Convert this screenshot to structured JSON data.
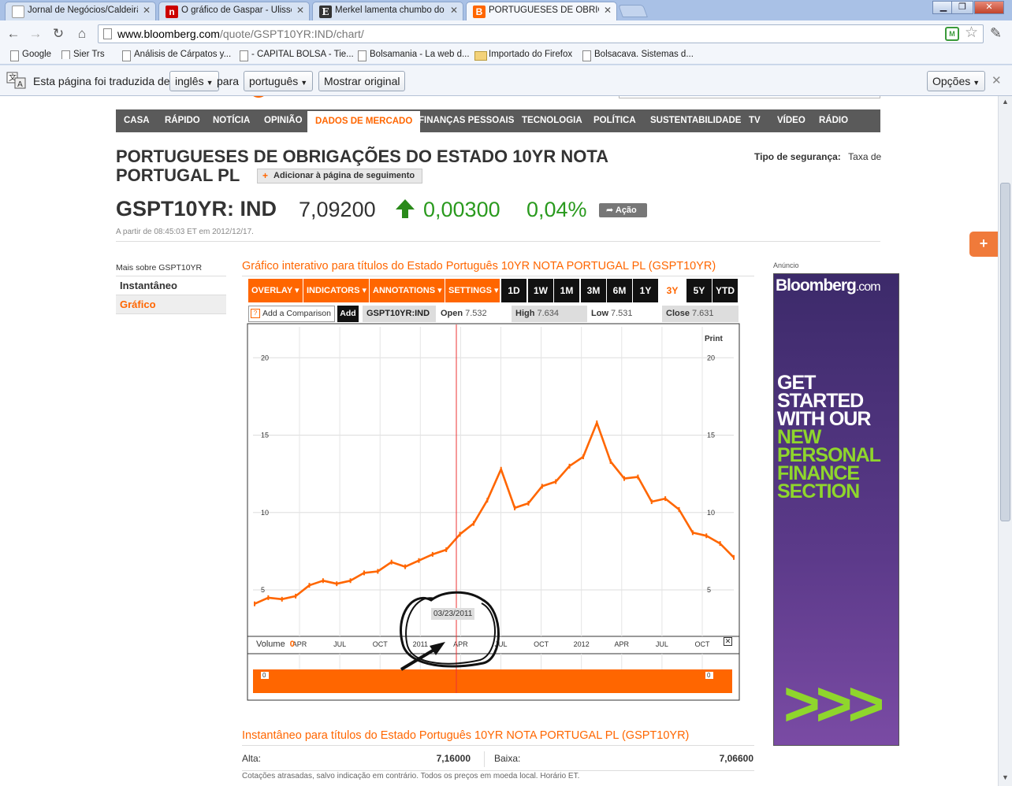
{
  "browser": {
    "tabs": [
      {
        "title": "Jornal de Negócios/Caldeirão",
        "icon": "page-icon"
      },
      {
        "title": "O gráfico de Gaspar - Ulisses",
        "icon": "n-favicon"
      },
      {
        "title": "Merkel lamenta chumbo do Pl",
        "icon": "e-favicon"
      },
      {
        "title": "PORTUGUESES DE OBRIGAÇ",
        "icon": "bloomberg-favicon"
      }
    ],
    "url_host": "www.bloomberg.com",
    "url_path": "/quote/GSPT10YR:IND/chart/",
    "bookmarks": [
      "Google",
      "Sier Trs",
      "Análisis de Cárpatos y...",
      "- CAPITAL BOLSA - Tie...",
      "Bolsamania - La web d...",
      "Importado do Firefox",
      "Bolsacava. Sistemas d..."
    ],
    "translate_bar": {
      "text1": "Esta página foi traduzida de",
      "from_lang": "inglês",
      "text2": "para",
      "to_lang": "português",
      "show_original": "Mostrar original",
      "options": "Opções"
    }
  },
  "nav": {
    "items": [
      "CASA",
      "RÁPIDO",
      "NOTÍCIA",
      "OPINIÃO",
      "DADOS DE MERCADO",
      "FINANÇAS PESSOAIS",
      "TECNOLOGIA",
      "POLÍTICA",
      "SUSTENTABILIDADE",
      "TV",
      "VÍDEO",
      "RÁDIO"
    ],
    "active": "DADOS DE MERCADO"
  },
  "quote": {
    "title_line1": "PORTUGUESES DE OBRIGAÇÕES DO ESTADO 10YR NOTA",
    "title_line2": "PORTUGAL PL",
    "follow_button": "Adicionar à página de seguimento",
    "security_type_label": "Tipo de segurança:",
    "security_type_value": "Taxa de",
    "ticker": "GSPT10YR: IND",
    "price": "7,09200",
    "change": "0,00300",
    "change_pct": "0,04%",
    "share_button": "Ação",
    "timestamp": "A partir de 08:45:03 ET em 2012/12/17.",
    "up_color": "#2a9a1e"
  },
  "left_nav": {
    "heading": "Mais sobre GSPT10YR",
    "items": [
      "Instantâneo",
      "Gráfico"
    ],
    "active": "Gráfico"
  },
  "chart_section": {
    "title": "Gráfico interativo para títulos do Estado Português 10YR NOTA PORTUGAL PL (GSPT10YR)",
    "menus": [
      "OVERLAY ▾",
      "INDICATORS ▾",
      "ANNOTATIONS ▾",
      "SETTINGS ▾"
    ],
    "ranges": [
      "1D",
      "1W",
      "1M",
      "3M",
      "6M",
      "1Y",
      "3Y",
      "5Y",
      "YTD"
    ],
    "active_range": "3Y",
    "comparison_placeholder": "Add a Comparison",
    "comparison_q": "?",
    "add_button": "Add",
    "symbol": "GSPT10YR:IND",
    "open_label": "Open",
    "open_value": "7.532",
    "high_label": "High",
    "high_value": "7.634",
    "low_label": "Low",
    "low_value": "7.531",
    "close_label": "Close",
    "close_value": "7.631",
    "print_label": "Print",
    "volume_label": "Volume",
    "volume_value": "0",
    "tooltip_date": "03/23/2011",
    "accent": "#ff6600"
  },
  "chart_data": {
    "type": "line",
    "xlabel": "",
    "ylabel": "",
    "ylim": [
      2,
      22
    ],
    "y_ticks": [
      5,
      10,
      15,
      20
    ],
    "x_tick_labels": [
      "APR",
      "JUL",
      "OCT",
      "2011",
      "APR",
      "JUL",
      "OCT",
      "2012",
      "APR",
      "JUL",
      "OCT"
    ],
    "grid": true,
    "series": [
      {
        "x": [
          "2010-01",
          "2010-02",
          "2010-03",
          "2010-04",
          "2010-05",
          "2010-06",
          "2010-07",
          "2010-08",
          "2010-09",
          "2010-10",
          "2010-11",
          "2010-12",
          "2011-01",
          "2011-02",
          "2011-03",
          "2011-04",
          "2011-05",
          "2011-06",
          "2011-07",
          "2011-08",
          "2011-09",
          "2011-10",
          "2011-11",
          "2011-12",
          "2012-01",
          "2012-02",
          "2012-03",
          "2012-04",
          "2012-05",
          "2012-06",
          "2012-07",
          "2012-08",
          "2012-09",
          "2012-10",
          "2012-11",
          "2012-12"
        ],
        "values": [
          4.1,
          4.5,
          4.4,
          4.6,
          5.3,
          5.6,
          5.4,
          5.6,
          6.1,
          6.2,
          6.8,
          6.5,
          6.9,
          7.3,
          7.6,
          8.6,
          9.3,
          10.8,
          12.8,
          10.3,
          10.6,
          11.7,
          12.0,
          13.0,
          13.6,
          15.8,
          13.3,
          12.2,
          12.3,
          10.7,
          10.9,
          10.2,
          8.7,
          8.5,
          8.0,
          7.1
        ]
      }
    ],
    "crosshair_date": "03/23/2011",
    "volume": [
      {
        "value": 0
      }
    ]
  },
  "snapshot": {
    "title": "Instantâneo para títulos do Estado Português 10YR NOTA PORTUGAL PL (GSPT10YR)",
    "high_label": "Alta:",
    "high_value": "7,16000",
    "low_label": "Baixa:",
    "low_value": "7,06600",
    "disclaimer": "Cotações atrasadas, salvo indicação em contrário. Todos os preços em moeda local. Horário ET."
  },
  "ad": {
    "label": "Anúncio",
    "brand": "Bloomberg",
    "brand_suffix": ".com",
    "line1": "GET",
    "line2": "STARTED",
    "line3": "WITH OUR",
    "line4": "NEW",
    "line5": "PERSONAL",
    "line6": "FINANCE",
    "line7": "SECTION",
    "arrows": ">>>",
    "white": "#ffffff",
    "green": "#8fd62c"
  }
}
